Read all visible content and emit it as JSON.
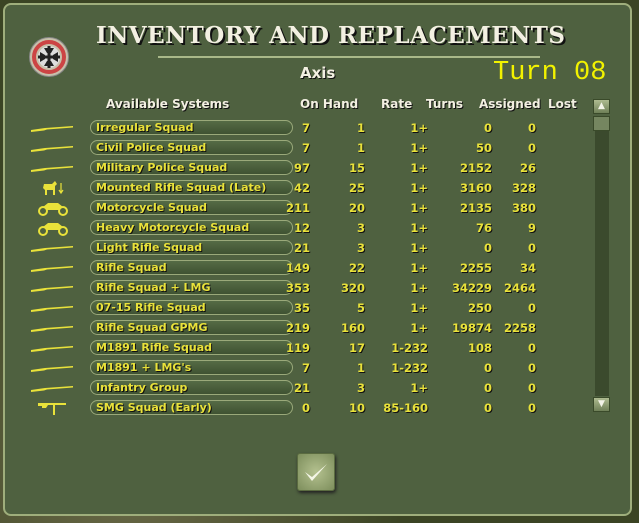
{
  "header": {
    "title": "INVENTORY AND REPLACEMENTS",
    "side": "Axis",
    "turn": "Turn 08"
  },
  "columns": {
    "system": "Available Systems",
    "on_hand": "On Hand",
    "rate": "Rate",
    "turns": "Turns",
    "assigned": "Assigned",
    "lost": "Lost"
  },
  "rows": [
    {
      "icon": "rifle",
      "name": "Irregular Squad",
      "on_hand": "7",
      "rate": "1",
      "turns": "1+",
      "assigned": "0",
      "lost": "0"
    },
    {
      "icon": "rifle",
      "name": "Civil Police Squad",
      "on_hand": "7",
      "rate": "1",
      "turns": "1+",
      "assigned": "50",
      "lost": "0"
    },
    {
      "icon": "rifle",
      "name": "Military Police Squad",
      "on_hand": "97",
      "rate": "15",
      "turns": "1+",
      "assigned": "2152",
      "lost": "26"
    },
    {
      "icon": "horse",
      "name": "Mounted Rifle Squad (Late)",
      "on_hand": "42",
      "rate": "25",
      "turns": "1+",
      "assigned": "3160",
      "lost": "328"
    },
    {
      "icon": "motorcycle",
      "name": "Motorcycle Squad",
      "on_hand": "211",
      "rate": "20",
      "turns": "1+",
      "assigned": "2135",
      "lost": "380"
    },
    {
      "icon": "motorcycle",
      "name": "Heavy Motorcycle Squad",
      "on_hand": "12",
      "rate": "3",
      "turns": "1+",
      "assigned": "76",
      "lost": "9"
    },
    {
      "icon": "rifle",
      "name": "Light Rifle Squad",
      "on_hand": "21",
      "rate": "3",
      "turns": "1+",
      "assigned": "0",
      "lost": "0"
    },
    {
      "icon": "rifle",
      "name": "Rifle Squad",
      "on_hand": "149",
      "rate": "22",
      "turns": "1+",
      "assigned": "2255",
      "lost": "34"
    },
    {
      "icon": "rifle",
      "name": "Rifle Squad + LMG",
      "on_hand": "353",
      "rate": "320",
      "turns": "1+",
      "assigned": "34229",
      "lost": "2464"
    },
    {
      "icon": "rifle",
      "name": "07-15 Rifle Squad",
      "on_hand": "35",
      "rate": "5",
      "turns": "1+",
      "assigned": "250",
      "lost": "0"
    },
    {
      "icon": "rifle",
      "name": "Rifle Squad GPMG",
      "on_hand": "219",
      "rate": "160",
      "turns": "1+",
      "assigned": "19874",
      "lost": "2258"
    },
    {
      "icon": "rifle",
      "name": "M1891 Rifle Squad",
      "on_hand": "119",
      "rate": "17",
      "turns": "1-232",
      "assigned": "108",
      "lost": "0"
    },
    {
      "icon": "rifle",
      "name": "M1891 + LMG's",
      "on_hand": "7",
      "rate": "1",
      "turns": "1-232",
      "assigned": "0",
      "lost": "0"
    },
    {
      "icon": "rifle",
      "name": "Infantry Group",
      "on_hand": "21",
      "rate": "3",
      "turns": "1+",
      "assigned": "0",
      "lost": "0"
    },
    {
      "icon": "smg",
      "name": "SMG Squad (Early)",
      "on_hand": "0",
      "rate": "10",
      "turns": "85-160",
      "assigned": "0",
      "lost": "0"
    }
  ],
  "colors": {
    "panel": "#4f6140",
    "text_yellow": "#e9e23a",
    "turn_yellow": "#f2f200"
  }
}
